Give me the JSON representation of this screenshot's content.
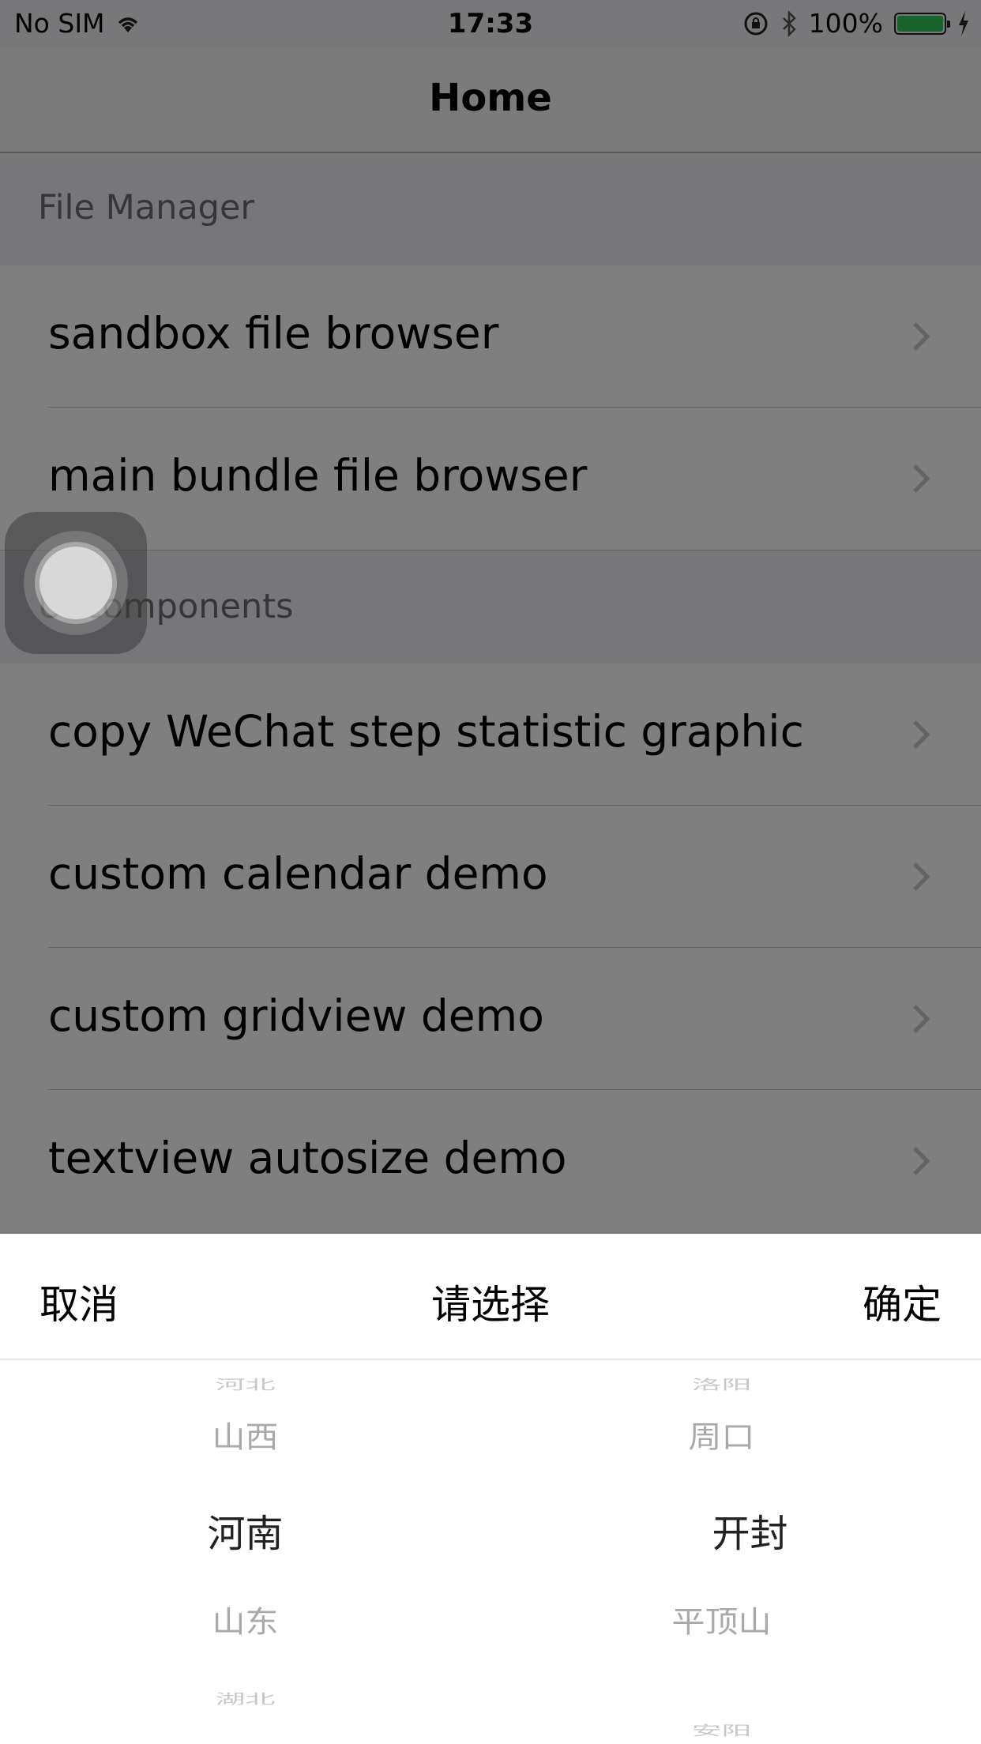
{
  "status_bar": {
    "carrier": "No SIM",
    "time": "17:33",
    "battery": "100%",
    "battery_level": 1.0
  },
  "nav": {
    "title": "Home"
  },
  "sections": [
    {
      "header": "File Manager",
      "items": [
        "sandbox file browser",
        "main bundle file browser"
      ]
    },
    {
      "header": "UI components",
      "items": [
        "copy WeChat step statistic graphic",
        "custom calendar demo",
        "custom gridview demo",
        "textview autosize demo"
      ]
    }
  ],
  "picker": {
    "cancel": "取消",
    "title": "请选择",
    "confirm": "确定",
    "province": {
      "options": [
        "河北",
        "山西",
        "河南",
        "山东",
        "湖北"
      ],
      "selected": "河南"
    },
    "city": {
      "options": [
        "洛阳",
        "周口",
        "开封",
        "平顶山",
        "安阳"
      ],
      "selected": "开封"
    }
  },
  "colors": {
    "battery_green": "#34c759",
    "overlay": "rgba(0,0,0,0.5)"
  }
}
